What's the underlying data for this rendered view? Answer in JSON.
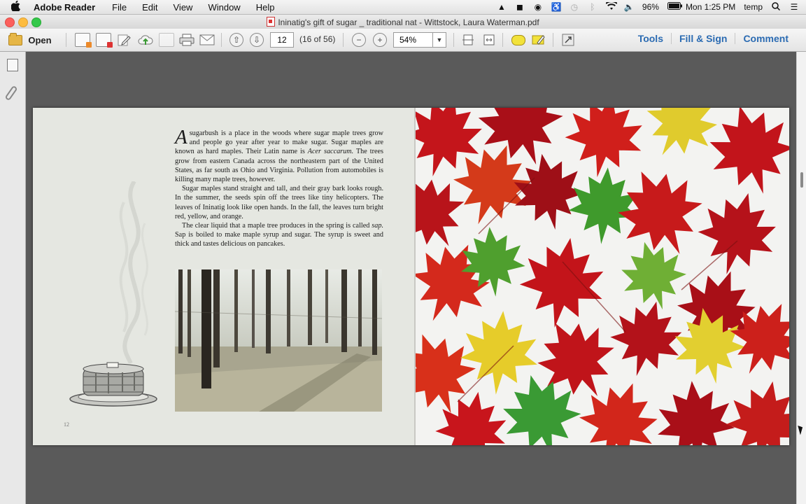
{
  "menubar": {
    "app_name": "Adobe Reader",
    "items": [
      "File",
      "Edit",
      "View",
      "Window",
      "Help"
    ],
    "battery": "96%",
    "clock": "Mon 1:25 PM",
    "user": "temp"
  },
  "window": {
    "title": "Ininatig's gift of sugar _ traditional nat - Wittstock, Laura Waterman.pdf"
  },
  "toolbar": {
    "open_label": "Open",
    "page_number": "12",
    "page_count": "(16 of 56)",
    "zoom": "54%",
    "tools_label": "Tools",
    "fill_sign_label": "Fill & Sign",
    "comment_label": "Comment"
  },
  "document": {
    "dropcap": "A",
    "p1_lead": "sugarbush is a place in the woods where sugar maple trees grow and people go year after year to make sugar. Sugar maples are known as hard maples. Their Latin name is ",
    "p1_latin": "Acer saccarum.",
    "p1_tail": " The trees grow from eastern Canada across the northeastern part of the United States, as far south as Ohio and Virginia. Pollution from automobiles is killing many maple trees, however.",
    "p2": "Sugar maples stand straight and tall, and their gray bark looks rough. In the summer, the seeds spin off the trees like tiny helicopters. The leaves of Ininatig look like open hands. In the fall, the leaves turn bright red, yellow, and orange.",
    "p3_lead": "The clear liquid that a maple tree produces in the spring is called ",
    "p3_sap": "sap.",
    "p3_tail": " Sap is boiled to make maple syrup and sugar. The syrup is sweet and thick and tastes delicious on pancakes.",
    "page_number": "12"
  },
  "colors": {
    "link_blue": "#2b6bb2",
    "leaf_red": "#c8151c",
    "leaf_green": "#3f9a2c",
    "leaf_yellow": "#e6cc2a"
  }
}
